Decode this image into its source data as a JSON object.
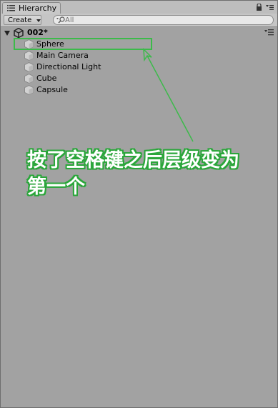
{
  "window": {
    "tab_label": "Hierarchy",
    "tab_icon": "list-icon",
    "lock_icon": "lock-icon",
    "menu_icon": "tab-menu-icon"
  },
  "toolbar": {
    "create_label": "Create",
    "search_placeholder": "All",
    "search_icon": "search-icon"
  },
  "scene": {
    "name": "002*",
    "icon": "unity-icon"
  },
  "hierarchy": {
    "items": [
      {
        "label": "Sphere",
        "icon": "gameobject-cube-icon"
      },
      {
        "label": "Main Camera",
        "icon": "gameobject-cube-icon"
      },
      {
        "label": "Directional Light",
        "icon": "gameobject-cube-icon"
      },
      {
        "label": "Cube",
        "icon": "gameobject-cube-icon"
      },
      {
        "label": "Capsule",
        "icon": "gameobject-cube-icon"
      }
    ]
  },
  "annotation": {
    "text": "按了空格键之后层级变为第一个",
    "color": "#3cba4a"
  }
}
